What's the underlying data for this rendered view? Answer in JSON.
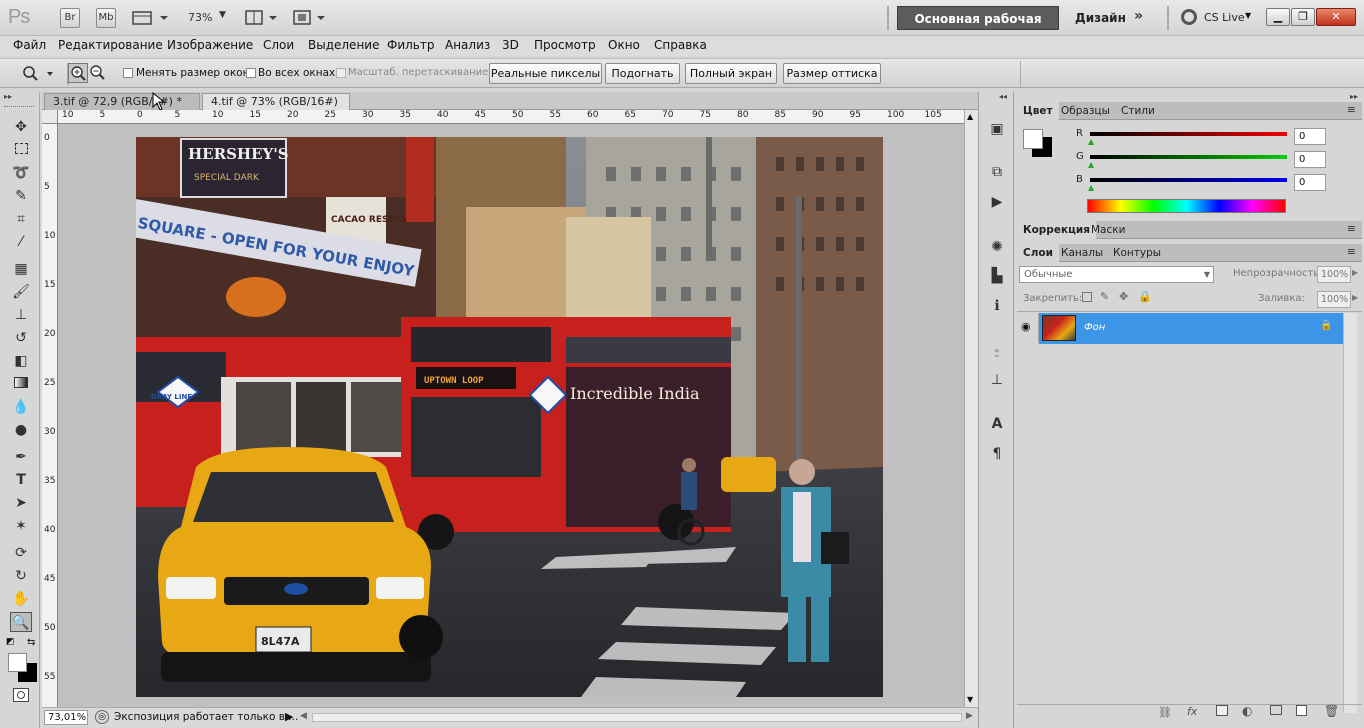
{
  "app": {
    "logo": "Ps",
    "bridge_btn": "Br",
    "minibridge_btn": "Mb",
    "zoom_value": "73%",
    "workspace_active": "Основная рабочая среда",
    "workspace_other": "Дизайн",
    "cs_live": "CS Live"
  },
  "menu": [
    "Файл",
    "Редактирование",
    "Изображение",
    "Слои",
    "Выделение",
    "Фильтр",
    "Анализ",
    "3D",
    "Просмотр",
    "Окно",
    "Справка"
  ],
  "options": {
    "resize_windows": "Менять размер окон",
    "all_windows": "Во всех окнах",
    "scrubby_zoom": "Масштаб. перетаскиванием",
    "actual_pixels": "Реальные пикселы",
    "fit_screen": "Подогнать",
    "fill_screen": "Полный экран",
    "print_size": "Размер оттиска"
  },
  "tabs": [
    {
      "label": "3.tif @ 72,9",
      "suffix": "(RGB/8#) *"
    },
    {
      "label": "4.tif @ 73% (RGB/16#)"
    }
  ],
  "ruler_top": [
    "10",
    "5",
    "0",
    "5",
    "10",
    "15",
    "20",
    "25",
    "30",
    "35",
    "40",
    "45",
    "50",
    "55",
    "60",
    "65",
    "70",
    "75",
    "80",
    "85",
    "90",
    "95",
    "100",
    "105"
  ],
  "ruler_left": [
    "0",
    "5",
    "10",
    "15",
    "20",
    "25",
    "30",
    "35",
    "40",
    "45",
    "50",
    "55"
  ],
  "status": {
    "zoom": "73,01%",
    "info": "Экспозиция работает только в ..."
  },
  "color_panel": {
    "tabs": [
      "Цвет",
      "Образцы",
      "Стили"
    ],
    "r_label": "R",
    "g_label": "G",
    "b_label": "B",
    "r": "0",
    "g": "0",
    "b": "0"
  },
  "adjust_panel": {
    "tabs": [
      "Коррекция",
      "Маски"
    ]
  },
  "layers_panel": {
    "tabs": [
      "Слои",
      "Каналы",
      "Контуры"
    ],
    "blend_mode": "Обычные",
    "opacity_label": "Непрозрачность:",
    "opacity": "100%",
    "lock_label": "Закрепить:",
    "fill_label": "Заливка:",
    "fill": "100%",
    "layer_name": "Фон"
  },
  "photo_text": {
    "hersheys": "HERSHEY'S",
    "special_dark": "SPECIAL DARK",
    "square_sign": "SQUARE - OPEN FOR YOUR ENJOY",
    "cacao": "CACAO RESERVE",
    "gray_line": "GRAY LINE",
    "uptown_loop": "UPTOWN LOOP",
    "incredible": "Incredible India",
    "plate": "8L47A"
  },
  "colors": {
    "accent_selection": "#3d95e8",
    "workspace_active_bg": "#5c5c5c",
    "bus_red": "#c8201c",
    "taxi_yellow": "#e8a814"
  }
}
